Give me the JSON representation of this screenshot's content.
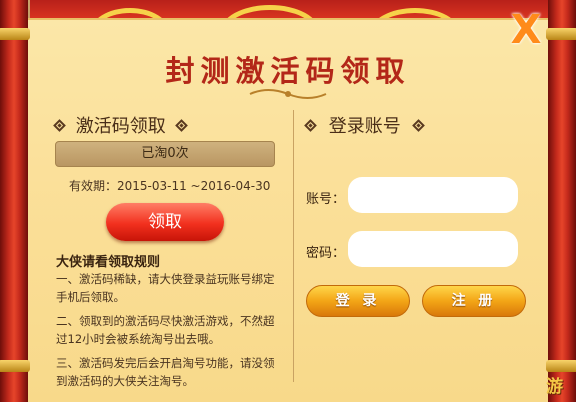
{
  "dialog": {
    "title": "封测激活码领取",
    "close_label": "X"
  },
  "left": {
    "heading": "激活码领取",
    "claimed_status": "已淘0次",
    "validity": "有效期：2015-03-11 ~2016-04-30",
    "claim_button": "领取",
    "rules_title": "大侠请看领取规则",
    "rules": [
      "一、激活码稀缺，请大侠登录益玩账号绑定手机后领取。",
      "二、领取到的激活码尽快激活游戏，不然超过12小时会被系统淘号出去哦。",
      "三、激活码发完后会开启淘号功能，请没领到激活码的大侠关注淘号。"
    ]
  },
  "right": {
    "heading": "登录账号",
    "account_label": "账号：",
    "password_label": "密码：",
    "account_value": "",
    "password_value": "",
    "login_button": "登 录",
    "register_button": "注 册"
  },
  "corner_logo": "游",
  "icons": [
    "close-icon",
    "diamond-icon",
    "title-ornament-icon"
  ],
  "colors": {
    "title": "#b32718",
    "claim_button": "#f2301e",
    "gold_button": "#f3a516",
    "paper": "#fbe09a",
    "close": "#ff8b1a"
  }
}
